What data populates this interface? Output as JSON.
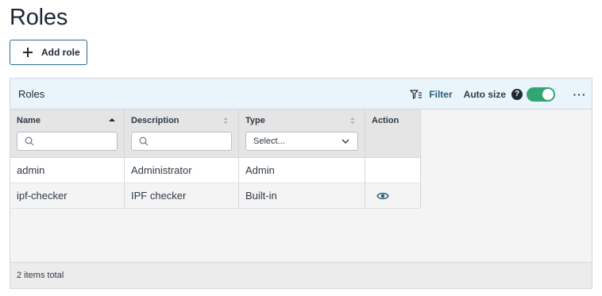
{
  "page": {
    "title": "Roles"
  },
  "toolbar": {
    "add_label": "Add role"
  },
  "panel": {
    "title": "Roles",
    "filter_label": "Filter",
    "autosize_label": "Auto size",
    "autosize_on": true,
    "help_glyph": "?",
    "more_glyph": "···"
  },
  "columns": [
    {
      "label": "Name",
      "filter": "search",
      "sort": "ascending"
    },
    {
      "label": "Description",
      "filter": "search",
      "sort": "none"
    },
    {
      "label": "Type",
      "filter": "select",
      "placeholder": "Select...",
      "sort": "none"
    },
    {
      "label": "Action"
    }
  ],
  "rows": [
    {
      "name": "admin",
      "description": "Administrator",
      "type": "Admin",
      "action": ""
    },
    {
      "name": "ipf-checker",
      "description": "IPF checker",
      "type": "Built-in",
      "action": "eye-icon"
    }
  ],
  "footer": {
    "total_text": "2 items total"
  },
  "colors": {
    "accent": "#2f6d8a",
    "toggle_on": "#31a672",
    "header_bg": "#eaf4fb",
    "link": "#2a5f7a"
  }
}
